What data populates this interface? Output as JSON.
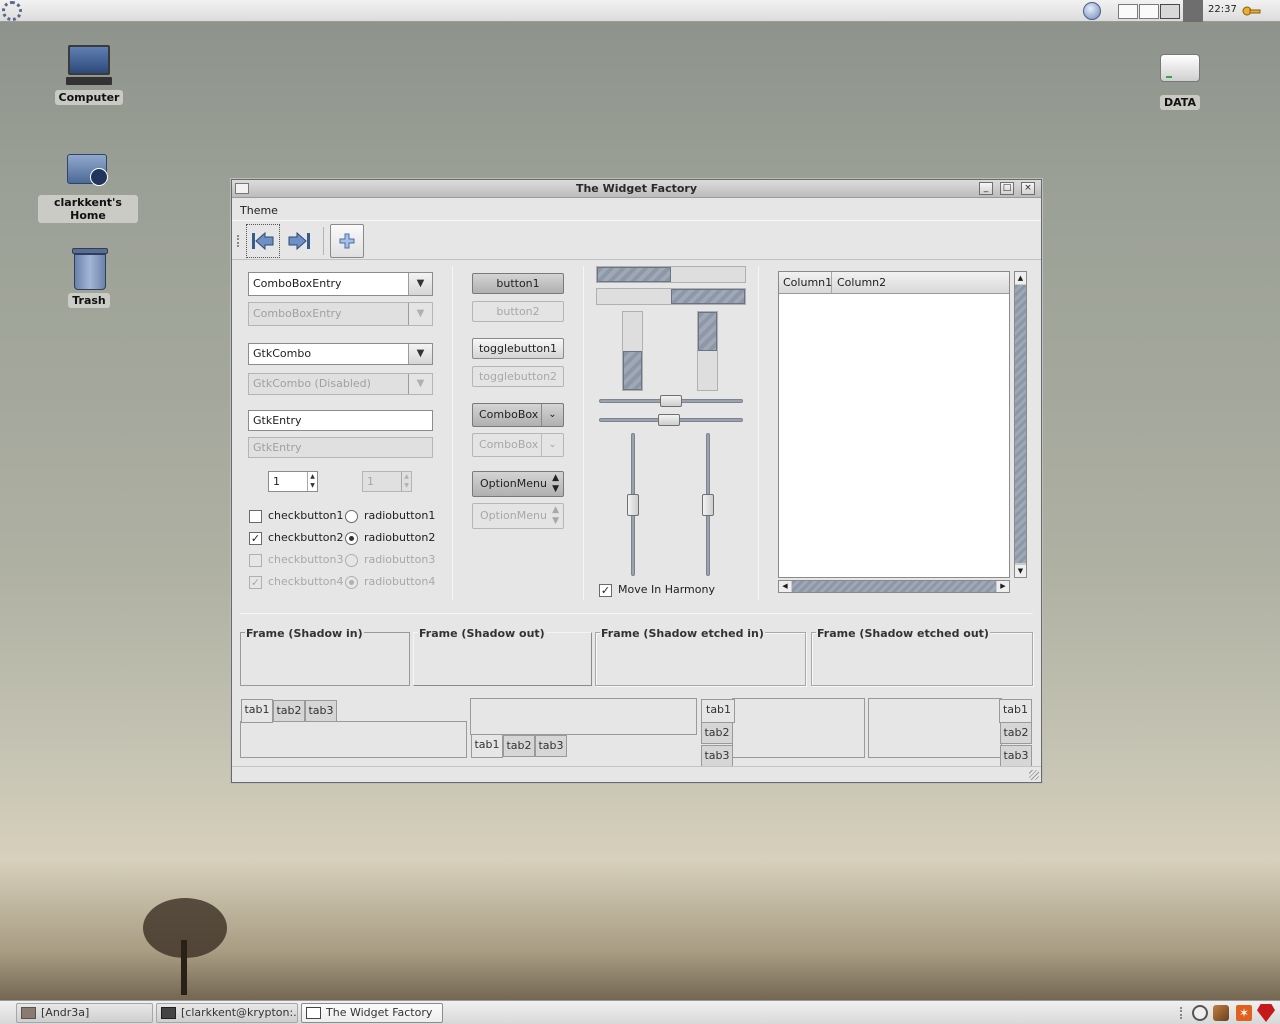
{
  "top_panel": {
    "clock": "22:37",
    "icons": [
      "gear-menu-icon",
      "network-icon",
      "keys-icon"
    ],
    "workspaces": 4
  },
  "desktop": {
    "icons": [
      {
        "label": "Computer",
        "icon": "computer-icon"
      },
      {
        "label": "clarkkent's Home",
        "icon": "home-folder-icon"
      },
      {
        "label": "Trash",
        "icon": "trash-icon"
      },
      {
        "label": "DATA",
        "icon": "drive-icon"
      }
    ]
  },
  "window": {
    "title": "The Widget Factory",
    "controls": {
      "minimize": "_",
      "maximize": "□",
      "close": "×"
    },
    "menu": [
      "Theme"
    ],
    "toolbar": [
      "go-first-icon",
      "go-last-icon",
      "add-icon"
    ]
  },
  "column1": {
    "combo_entry": {
      "value": "ComboBoxEntry",
      "disabled_value": "ComboBoxEntry"
    },
    "gtk_combo": {
      "value": "GtkCombo",
      "disabled_value": "GtkCombo (Disabled)"
    },
    "gtk_entry": {
      "value": "GtkEntry",
      "disabled_value": "GtkEntry"
    },
    "spin": {
      "value": "1",
      "disabled_value": "1"
    },
    "checkbuttons": [
      {
        "label": "checkbutton1",
        "checked": false,
        "disabled": false
      },
      {
        "label": "checkbutton2",
        "checked": true,
        "disabled": false
      },
      {
        "label": "checkbutton3",
        "checked": false,
        "disabled": true
      },
      {
        "label": "checkbutton4",
        "checked": true,
        "disabled": true
      }
    ],
    "radiobuttons": [
      {
        "label": "radiobutton1",
        "checked": false,
        "disabled": false
      },
      {
        "label": "radiobutton2",
        "checked": true,
        "disabled": false
      },
      {
        "label": "radiobutton3",
        "checked": false,
        "disabled": true
      },
      {
        "label": "radiobutton4",
        "checked": true,
        "disabled": true
      }
    ]
  },
  "column2": {
    "button1": "button1",
    "button2": "button2",
    "togglebutton1": "togglebutton1",
    "togglebutton2": "togglebutton2",
    "combobox": "ComboBox",
    "combobox_disabled": "ComboBox",
    "optionmenu": "OptionMenu",
    "optionmenu_disabled": "OptionMenu"
  },
  "column3": {
    "progress_h": [
      0.5,
      0.5
    ],
    "progress_v": [
      0.5,
      0.5
    ],
    "hscale_values": [
      0.5,
      0.48
    ],
    "vscale_values": [
      0.5,
      0.5
    ],
    "move_in_harmony": {
      "label": "Move In Harmony",
      "checked": true
    }
  },
  "treeview": {
    "columns": [
      "Column1",
      "Column2"
    ]
  },
  "frames": [
    "Frame (Shadow in)",
    "Frame (Shadow out)",
    "Frame (Shadow etched in)",
    "Frame (Shadow etched out)"
  ],
  "notebooks": {
    "tabs": [
      "tab1",
      "tab2",
      "tab3"
    ]
  },
  "taskbar": {
    "tasks": [
      {
        "label": "[Andr3a]",
        "active": false
      },
      {
        "label": "[clarkkent@krypton:...",
        "active": false
      },
      {
        "label": "The Widget Factory",
        "active": true
      }
    ],
    "tray": [
      "clock-icon",
      "tools-icon",
      "star-icon",
      "ruby-icon"
    ]
  }
}
